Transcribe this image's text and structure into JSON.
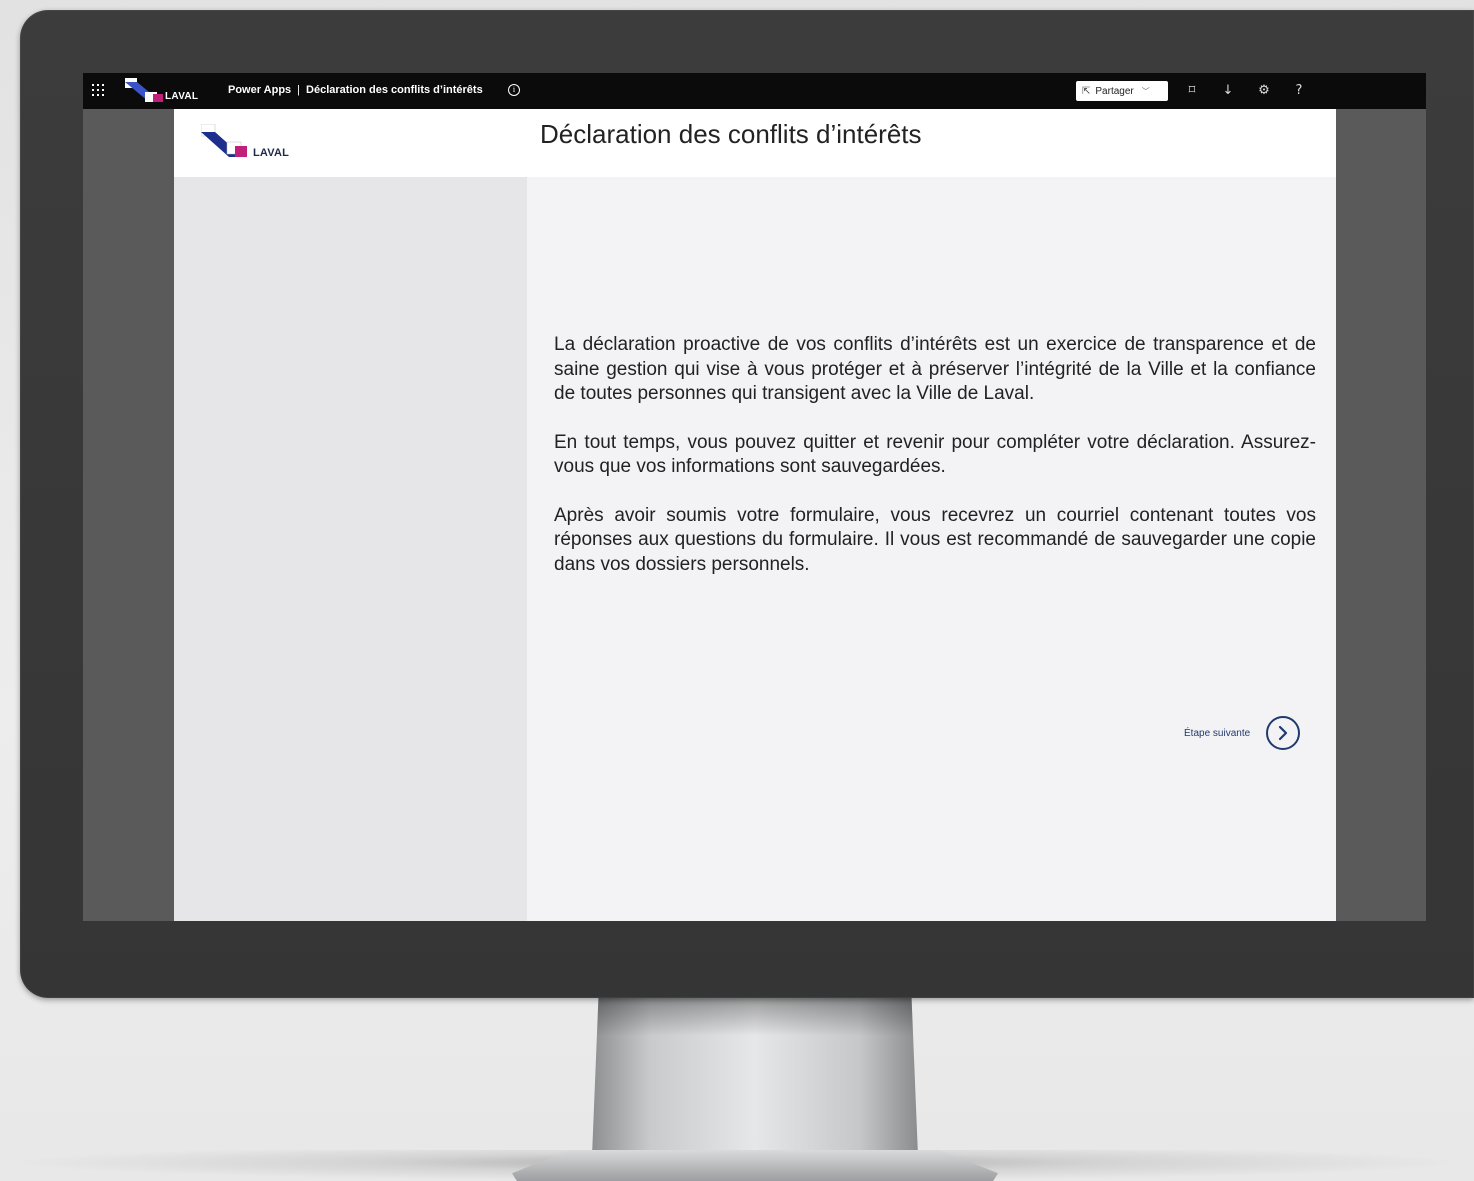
{
  "topbar": {
    "logo_text": "LAVAL",
    "app_name": "Power Apps",
    "separator": "|",
    "app_title": "Déclaration des conflits d’intérêts",
    "share_label": "Partager",
    "icons": [
      "waffle-icon",
      "info-icon",
      "share-icon",
      "chevron-down-icon",
      "fit-to-screen-icon",
      "download-icon",
      "settings-icon",
      "help-icon"
    ],
    "help_glyph": "?"
  },
  "app": {
    "header_logo_text": "LAVAL",
    "title": "Déclaration des conflits d’intérêts",
    "paragraphs": [
      "La déclaration proactive de vos conflits d’intérêts est un exercice de transparence et de saine gestion qui vise à vous protéger et à préserver l’intégrité de la Ville et la confiance de toutes personnes qui transigent avec la Ville de Laval.",
      "En tout temps, vous pouvez quitter et revenir pour compléter votre déclaration. Assurez-vous que vos informations sont sauvegardées.",
      "Après avoir soumis votre formulaire, vous recevrez un courriel contenant toutes vos réponses aux questions du formulaire. Il vous est recommandé de sauvegarder une copie dans vos dossiers personnels."
    ],
    "next_label": "Étape suivante"
  },
  "colors": {
    "topbar": "#0b0b0b",
    "accent": "#1f3a6e",
    "logo_blue": "#1c2f8c",
    "logo_magenta": "#c1207a",
    "side_panel": "#e6e6e8",
    "content_bg": "#f3f3f5"
  }
}
